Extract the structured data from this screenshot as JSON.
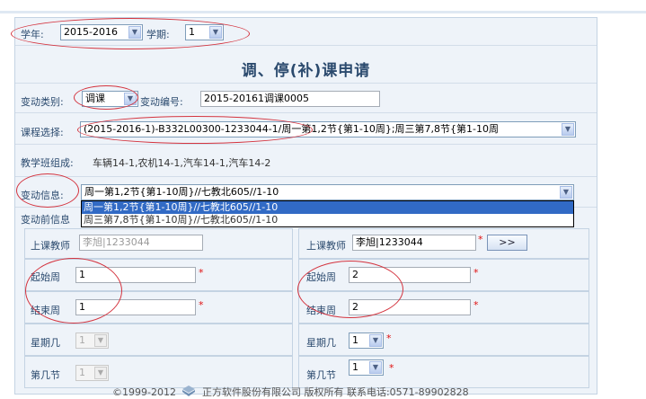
{
  "filters": {
    "year_label": "学年:",
    "year_value": "2015-2016",
    "term_label": "学期:",
    "term_value": "1"
  },
  "form_title": "调、停(补)课申请",
  "change_type": {
    "label": "变动类别:",
    "value": "调课",
    "number_label": "变动编号:",
    "number_value": "2015-20161调课0005"
  },
  "course": {
    "label": "课程选择:",
    "value": "(2015-2016-1)-B332L00300-1233044-1/周一第1,2节{第1-10周};周三第7,8节{第1-10周"
  },
  "class_composition": {
    "label": "教学班组成:",
    "value": "车辆14-1,农机14-1,汽车14-1,汽车14-2"
  },
  "change_info": {
    "label": "变动信息:",
    "value": "周一第1,2节{第1-10周}//七教北605//1-10",
    "options": [
      "周一第1,2节{第1-10周}//七教北605//1-10",
      "周三第7,8节{第1-10周}//七教北605//1-10"
    ],
    "highlighted_index": 0
  },
  "before_section": {
    "label": "变动前信息",
    "teacher_label": "上课教师",
    "teacher_value": "李旭|1233044",
    "start_week_label": "起始周",
    "start_week_value": "1",
    "end_week_label": "结束周",
    "end_week_value": "1",
    "weekday_label": "星期几",
    "weekday_value": "1",
    "period_label": "第几节",
    "period_value": "1"
  },
  "after_section": {
    "teacher_label": "上课教师",
    "teacher_value": "李旭|1233044",
    "pick_button": ">>",
    "start_week_label": "起始周",
    "start_week_value": "2",
    "end_week_label": "结束周",
    "end_week_value": "2",
    "weekday_label": "星期几",
    "weekday_value": "1",
    "period_label": "第几节",
    "period_value": "1"
  },
  "required_mark": "*",
  "footer": {
    "copyright": "©1999-2012",
    "company": "正方软件股份有限公司",
    "rights": "版权所有",
    "phone": "联系电话:0571-89902828"
  },
  "colors": {
    "annotation_circle": "#d4343f",
    "highlight": "#316ac5",
    "label_text": "#2b4a6e",
    "required": "#e01010"
  }
}
